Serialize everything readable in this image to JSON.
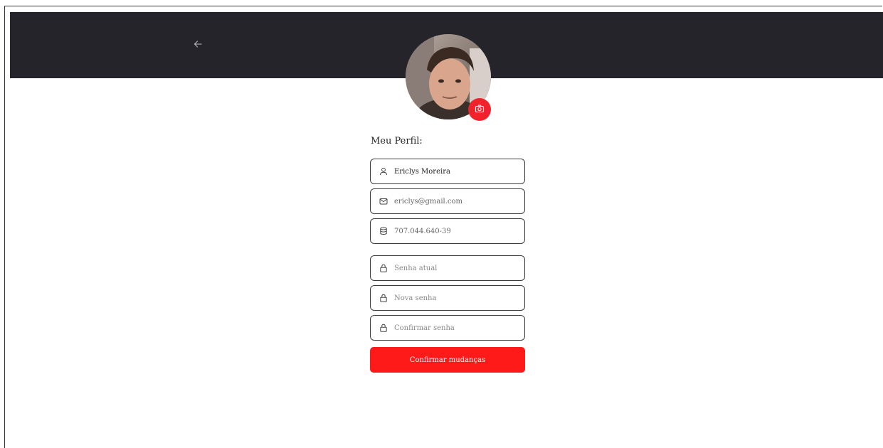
{
  "header": {
    "back_icon": "arrow-left-icon",
    "bg_color": "#25242b"
  },
  "avatar": {
    "alt": "Foto de perfil",
    "camera_icon": "camera-icon",
    "accent_color": "#f2222a"
  },
  "profile": {
    "title": "Meu Perfil:"
  },
  "fields": {
    "name": {
      "icon": "user-icon",
      "value": "Ericlys Moreira"
    },
    "email": {
      "icon": "mail-icon",
      "value": "ericlys@gmail.com"
    },
    "document": {
      "icon": "database-icon",
      "value": "707.044.640-39"
    },
    "current_password": {
      "icon": "lock-icon",
      "placeholder": "Senha atual"
    },
    "new_password": {
      "icon": "lock-icon",
      "placeholder": "Nova senha"
    },
    "confirm_password": {
      "icon": "lock-icon",
      "placeholder": "Confirmar senha"
    }
  },
  "actions": {
    "submit_label": "Confirmar mudanças",
    "submit_color": "#ff1a1a"
  }
}
